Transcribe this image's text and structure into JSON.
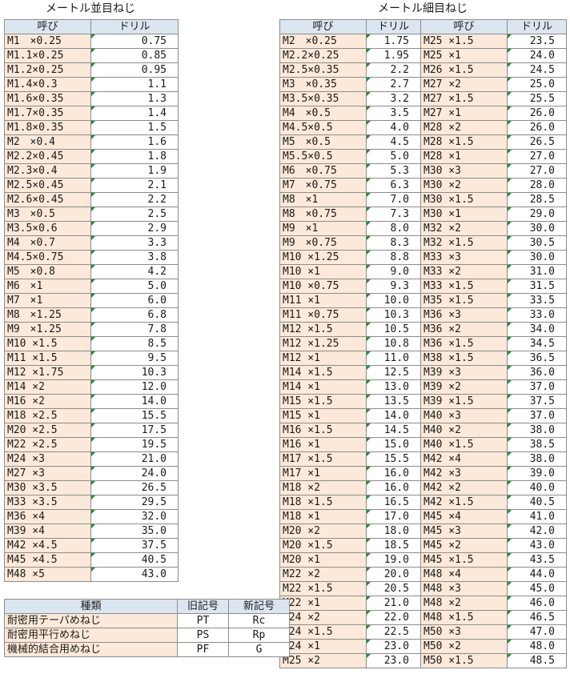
{
  "coarse": {
    "title": "メートル並目ねじ",
    "headers": [
      "呼び",
      "ドリル"
    ],
    "rows": [
      [
        "M1　×0.25",
        "0.75"
      ],
      [
        "M1.1×0.25",
        "0.85"
      ],
      [
        "M1.2×0.25",
        "0.95"
      ],
      [
        "M1.4×0.3",
        "1.1"
      ],
      [
        "M1.6×0.35",
        "1.3"
      ],
      [
        "M1.7×0.35",
        "1.4"
      ],
      [
        "M1.8×0.35",
        "1.5"
      ],
      [
        "M2　×0.4",
        "1.6"
      ],
      [
        "M2.2×0.45",
        "1.8"
      ],
      [
        "M2.3×0.4",
        "1.9"
      ],
      [
        "M2.5×0.45",
        "2.1"
      ],
      [
        "M2.6×0.45",
        "2.2"
      ],
      [
        "M3　×0.5",
        "2.5"
      ],
      [
        "M3.5×0.6",
        "2.9"
      ],
      [
        "M4　×0.7",
        "3.3"
      ],
      [
        "M4.5×0.75",
        "3.8"
      ],
      [
        "M5　×0.8",
        "4.2"
      ],
      [
        "M6　×1",
        "5.0"
      ],
      [
        "M7　×1",
        "6.0"
      ],
      [
        "M8　×1.25",
        "6.8"
      ],
      [
        "M9　×1.25",
        "7.8"
      ],
      [
        "M10 ×1.5",
        "8.5"
      ],
      [
        "M11 ×1.5",
        "9.5"
      ],
      [
        "M12 ×1.75",
        "10.3"
      ],
      [
        "M14 ×2",
        "12.0"
      ],
      [
        "M16 ×2",
        "14.0"
      ],
      [
        "M18 ×2.5",
        "15.5"
      ],
      [
        "M20 ×2.5",
        "17.5"
      ],
      [
        "M22 ×2.5",
        "19.5"
      ],
      [
        "M24 ×3",
        "21.0"
      ],
      [
        "M27 ×3",
        "24.0"
      ],
      [
        "M30 ×3.5",
        "26.5"
      ],
      [
        "M33 ×3.5",
        "29.5"
      ],
      [
        "M36 ×4",
        "32.0"
      ],
      [
        "M39 ×4",
        "35.0"
      ],
      [
        "M42 ×4.5",
        "37.5"
      ],
      [
        "M45 ×4.5",
        "40.5"
      ],
      [
        "M48 ×5",
        "43.0"
      ]
    ]
  },
  "fine": {
    "title": "メートル細目ねじ",
    "headers": [
      "呼び",
      "ドリル",
      "呼び",
      "ドリル"
    ],
    "rows": [
      [
        "M2　×0.25",
        "1.75",
        "M25 ×1.5",
        "23.5"
      ],
      [
        "M2.2×0.25",
        "1.95",
        "M25 ×1",
        "24.0"
      ],
      [
        "M2.5×0.35",
        "2.2",
        "M26 ×1.5",
        "24.5"
      ],
      [
        "M3　×0.35",
        "2.7",
        "M27 ×2",
        "25.0"
      ],
      [
        "M3.5×0.35",
        "3.2",
        "M27 ×1.5",
        "25.5"
      ],
      [
        "M4　×0.5",
        "3.5",
        "M27 ×1",
        "26.0"
      ],
      [
        "M4.5×0.5",
        "4.0",
        "M28 ×2",
        "26.0"
      ],
      [
        "M5　×0.5",
        "4.5",
        "M28 ×1.5",
        "26.5"
      ],
      [
        "M5.5×0.5",
        "5.0",
        "M28 ×1",
        "27.0"
      ],
      [
        "M6　×0.75",
        "5.3",
        "M30 ×3",
        "27.0"
      ],
      [
        "M7　×0.75",
        "6.3",
        "M30 ×2",
        "28.0"
      ],
      [
        "M8　×1",
        "7.0",
        "M30 ×1.5",
        "28.5"
      ],
      [
        "M8　×0.75",
        "7.3",
        "M30 ×1",
        "29.0"
      ],
      [
        "M9　×1",
        "8.0",
        "M32 ×2",
        "30.0"
      ],
      [
        "M9　×0.75",
        "8.3",
        "M32 ×1.5",
        "30.5"
      ],
      [
        "M10 ×1.25",
        "8.8",
        "M33 ×3",
        "30.0"
      ],
      [
        "M10 ×1",
        "9.0",
        "M33 ×2",
        "31.0"
      ],
      [
        "M10 ×0.75",
        "9.3",
        "M33 ×1.5",
        "31.5"
      ],
      [
        "M11 ×1",
        "10.0",
        "M35 ×1.5",
        "33.5"
      ],
      [
        "M11 ×0.75",
        "10.3",
        "M36 ×3",
        "33.0"
      ],
      [
        "M12 ×1.5",
        "10.5",
        "M36 ×2",
        "34.0"
      ],
      [
        "M12 ×1.25",
        "10.8",
        "M36 ×1.5",
        "34.5"
      ],
      [
        "M12 ×1",
        "11.0",
        "M38 ×1.5",
        "36.5"
      ],
      [
        "M14 ×1.5",
        "12.5",
        "M39 ×3",
        "36.0"
      ],
      [
        "M14 ×1",
        "13.0",
        "M39 ×2",
        "37.0"
      ],
      [
        "M15 ×1.5",
        "13.5",
        "M39 ×1.5",
        "37.5"
      ],
      [
        "M15 ×1",
        "14.0",
        "M40 ×3",
        "37.0"
      ],
      [
        "M16 ×1.5",
        "14.5",
        "M40 ×2",
        "38.0"
      ],
      [
        "M16 ×1",
        "15.0",
        "M40 ×1.5",
        "38.5"
      ],
      [
        "M17 ×1.5",
        "15.5",
        "M42 ×4",
        "38.0"
      ],
      [
        "M17 ×1",
        "16.0",
        "M42 ×3",
        "39.0"
      ],
      [
        "M18 ×2",
        "16.0",
        "M42 ×2",
        "40.0"
      ],
      [
        "M18 ×1.5",
        "16.5",
        "M42 ×1.5",
        "40.5"
      ],
      [
        "M18 ×1",
        "17.0",
        "M45 ×4",
        "41.0"
      ],
      [
        "M20 ×2",
        "18.0",
        "M45 ×3",
        "42.0"
      ],
      [
        "M20 ×1.5",
        "18.5",
        "M45 ×2",
        "43.0"
      ],
      [
        "M20 ×1",
        "19.0",
        "M45 ×1.5",
        "43.5"
      ],
      [
        "M22 ×2",
        "20.0",
        "M48 ×4",
        "44.0"
      ],
      [
        "M22 ×1.5",
        "20.5",
        "M48 ×3",
        "45.0"
      ],
      [
        "M22 ×1",
        "21.0",
        "M48 ×2",
        "46.0"
      ],
      [
        "M24 ×2",
        "22.0",
        "M48 ×1.5",
        "46.5"
      ],
      [
        "M24 ×1.5",
        "22.5",
        "M50 ×3",
        "47.0"
      ],
      [
        "M24 ×1",
        "23.0",
        "M50 ×2",
        "48.0"
      ],
      [
        "M25 ×2",
        "23.0",
        "M50 ×1.5",
        "48.5"
      ]
    ]
  },
  "pipe": {
    "headers": [
      "種類",
      "旧記号",
      "新記号"
    ],
    "rows": [
      [
        "耐密用テーパめねじ",
        "PT",
        "Rc"
      ],
      [
        "耐密用平行めねじ",
        "PS",
        "Rp"
      ],
      [
        "機械的結合用めねじ",
        "PF",
        "G"
      ]
    ]
  },
  "colors": {
    "name_cell": "#fde9d9",
    "header": "#dce6f1",
    "grid": "#8c8c8c",
    "marker": "#1f8a2e"
  }
}
